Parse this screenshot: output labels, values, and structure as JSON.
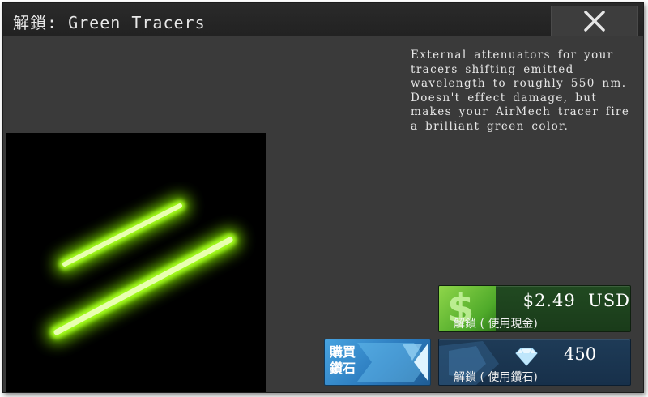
{
  "dialog": {
    "title": "解鎖: Green Tracers",
    "close_icon": "close-x-icon"
  },
  "item": {
    "name": "Green Tracers",
    "preview_icon": "green-tracer-beams-image",
    "tracer_color": "#9cff1a",
    "description": "External attenuators for your tracers shifting emitted wavelength to roughly 550 nm. Doesn't effect damage, but makes your AirMech tracer fire a brilliant green color."
  },
  "purchase": {
    "cash": {
      "price": "$2.49  USD",
      "label": "解鎖 ( 使用現金)",
      "icon": "dollar-sign-icon",
      "color": "#2f6a2f"
    },
    "buy_diamonds": {
      "label": "購買 鑽石",
      "icon": "diamond-gem-icon",
      "color": "#2a86cc"
    },
    "diamonds": {
      "amount": "450",
      "label": "解鎖 ( 使用鑽石)",
      "icon": "diamond-icon",
      "color": "#1e3b57"
    }
  }
}
